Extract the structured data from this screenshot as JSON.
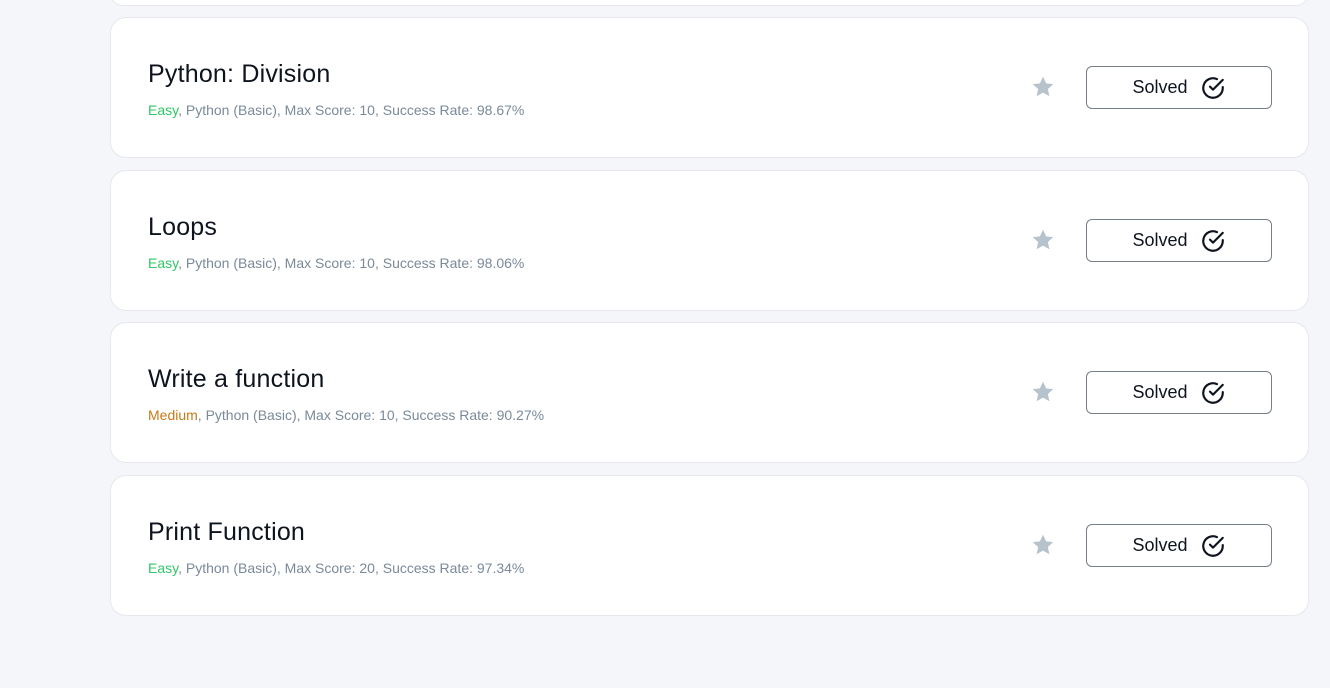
{
  "colors": {
    "easy": "#2ec866",
    "medium": "#c77a16",
    "star": "#b7c3cc",
    "background": "#f5f6fa"
  },
  "challenges": [
    {
      "title": "Python: Division",
      "difficulty": "Easy",
      "difficulty_level": "easy",
      "details": ", Python (Basic), Max Score: 10, Success Rate: 98.67%",
      "button_label": "Solved",
      "star_icon": "star-icon",
      "check_icon": "check-circle-icon"
    },
    {
      "title": "Loops",
      "difficulty": "Easy",
      "difficulty_level": "easy",
      "details": ", Python (Basic), Max Score: 10, Success Rate: 98.06%",
      "button_label": "Solved",
      "star_icon": "star-icon",
      "check_icon": "check-circle-icon"
    },
    {
      "title": "Write a function",
      "difficulty": "Medium",
      "difficulty_level": "medium",
      "details": ", Python (Basic), Max Score: 10, Success Rate: 90.27%",
      "button_label": "Solved",
      "star_icon": "star-icon",
      "check_icon": "check-circle-icon"
    },
    {
      "title": "Print Function",
      "difficulty": "Easy",
      "difficulty_level": "easy",
      "details": ", Python (Basic), Max Score: 20, Success Rate: 97.34%",
      "button_label": "Solved",
      "star_icon": "star-icon",
      "check_icon": "check-circle-icon"
    }
  ]
}
